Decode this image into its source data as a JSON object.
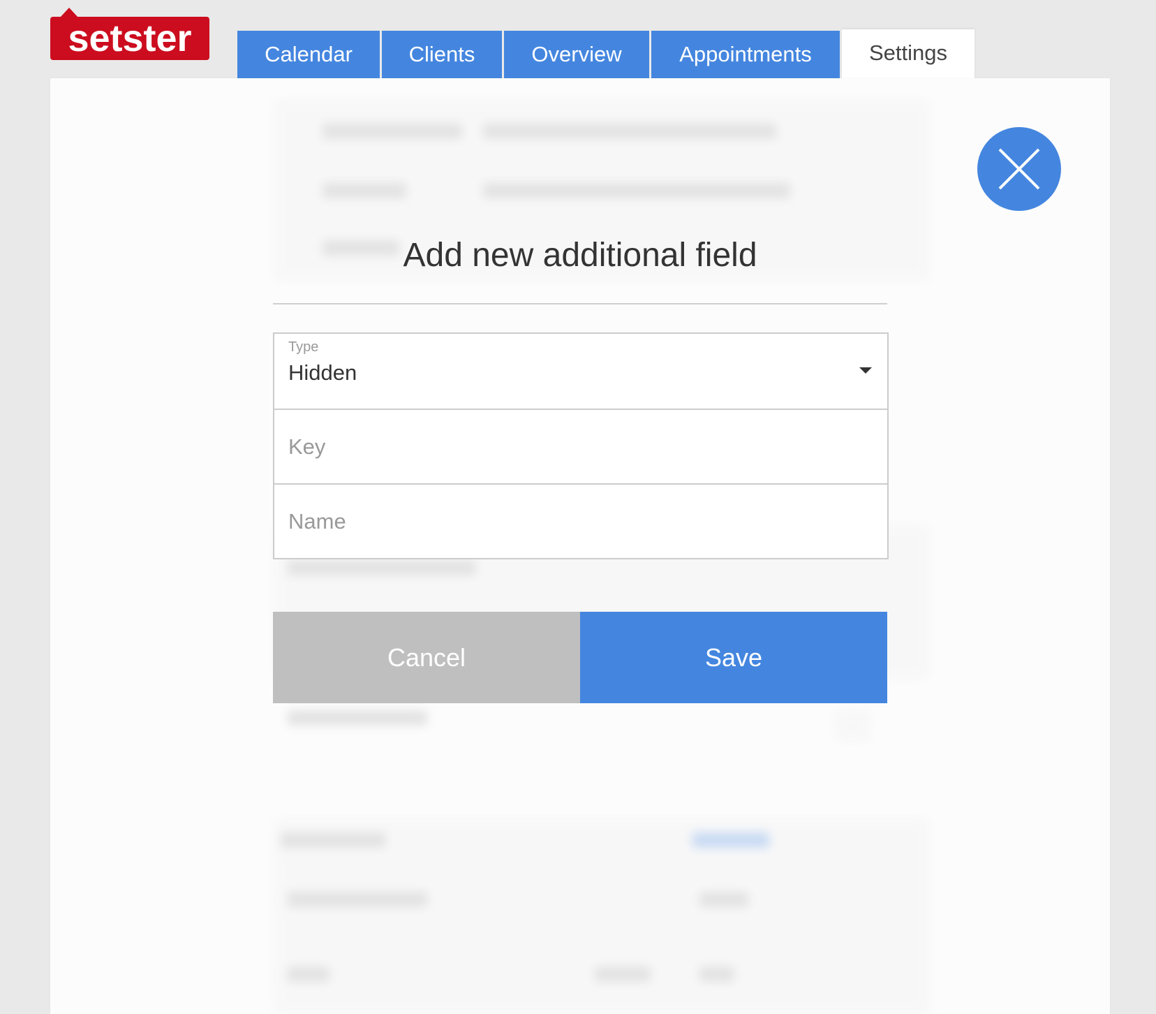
{
  "app": {
    "logo_text": "setster"
  },
  "tabs": [
    {
      "label": "Calendar"
    },
    {
      "label": "Clients"
    },
    {
      "label": "Overview"
    },
    {
      "label": "Appointments"
    },
    {
      "label": "Settings",
      "active": true
    }
  ],
  "dialog": {
    "title": "Add new additional field",
    "type_field": {
      "label": "Type",
      "value": "Hidden"
    },
    "key_field": {
      "placeholder": "Key",
      "value": ""
    },
    "name_field": {
      "placeholder": "Name",
      "value": ""
    },
    "cancel_label": "Cancel",
    "save_label": "Save"
  },
  "colors": {
    "brand_red": "#cc0d1f",
    "accent_blue": "#4486df",
    "cancel_gray": "#bfbfbf"
  },
  "icons": {
    "close": "close-icon",
    "dropdown": "chevron-down-icon"
  }
}
